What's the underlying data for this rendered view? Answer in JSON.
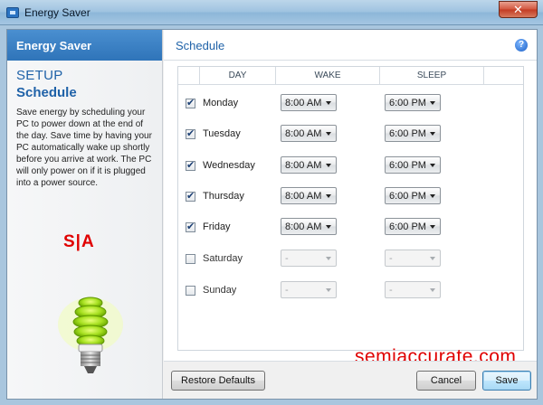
{
  "window": {
    "title": "Energy Saver",
    "close_label": "✕"
  },
  "sidebar": {
    "header": "Energy Saver",
    "setup": "SETUP",
    "section": "Schedule",
    "description": "Save energy by scheduling your PC to power down at the end of the day. Save time by having your PC automatically wake up shortly before you arrive at work. The PC will only power on if it is plugged into a power source.",
    "logo_text": "S|A"
  },
  "main": {
    "title": "Schedule",
    "help_label": "?",
    "columns": {
      "day": "DAY",
      "wake": "WAKE",
      "sleep": "SLEEP"
    },
    "rows": [
      {
        "day": "Monday",
        "checked": true,
        "wake": "8:00 AM",
        "sleep": "6:00 PM"
      },
      {
        "day": "Tuesday",
        "checked": true,
        "wake": "8:00 AM",
        "sleep": "6:00 PM"
      },
      {
        "day": "Wednesday",
        "checked": true,
        "wake": "8:00 AM",
        "sleep": "6:00 PM"
      },
      {
        "day": "Thursday",
        "checked": true,
        "wake": "8:00 AM",
        "sleep": "6:00 PM"
      },
      {
        "day": "Friday",
        "checked": true,
        "wake": "8:00 AM",
        "sleep": "6:00 PM"
      },
      {
        "day": "Saturday",
        "checked": false,
        "wake": "-",
        "sleep": "-"
      },
      {
        "day": "Sunday",
        "checked": false,
        "wake": "-",
        "sleep": "-"
      }
    ],
    "watermark": "semiaccurate.com"
  },
  "footer": {
    "restore_label": "Restore Defaults",
    "cancel_label": "Cancel",
    "save_label": "Save"
  },
  "colors": {
    "accent": "#1f62a8",
    "header_blue": "#2f74b9",
    "brand_red": "#e00000"
  },
  "icons": {
    "app": "app-icon",
    "help": "help-icon",
    "close": "close-icon",
    "bulb": "lightbulb-icon"
  }
}
